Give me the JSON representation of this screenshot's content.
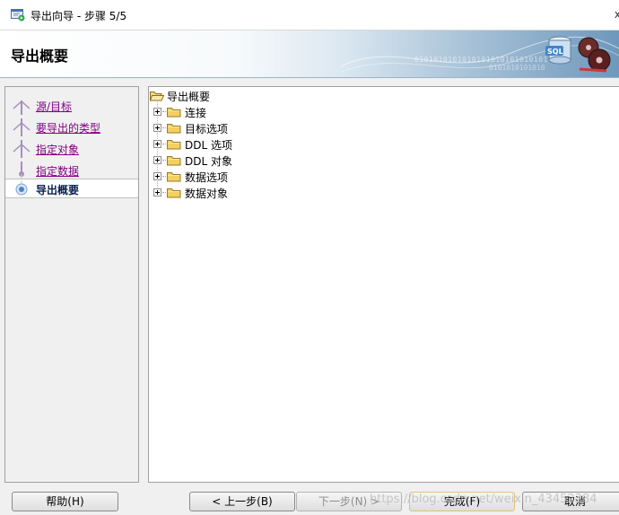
{
  "window": {
    "title": "导出向导 - 步骤 5/5",
    "close_glyph": "x"
  },
  "banner": {
    "heading": "导出概要",
    "binary_line1": "0101010101010101010101010101",
    "binary_line2": "0101010101010"
  },
  "steps": [
    {
      "label": "源/目标",
      "state": "done"
    },
    {
      "label": "要导出的类型",
      "state": "done"
    },
    {
      "label": "指定对象",
      "state": "done"
    },
    {
      "label": "指定数据",
      "state": "done"
    },
    {
      "label": "导出概要",
      "state": "current"
    }
  ],
  "tree": {
    "root": "导出概要",
    "items": [
      "连接",
      "目标选项",
      "DDL 选项",
      "DDL 对象",
      "数据选项",
      "数据对象"
    ]
  },
  "buttons": {
    "help": "帮助(H)",
    "back": "< 上一步(B)",
    "next": "下一步(N) >",
    "finish": "完成(F)",
    "cancel": "取消"
  },
  "watermark": "https://blog.csdn.net/weixin_43452384",
  "colors": {
    "visited_link": "#800080",
    "current_step": "#0a2250",
    "folder": "#f4d060"
  }
}
